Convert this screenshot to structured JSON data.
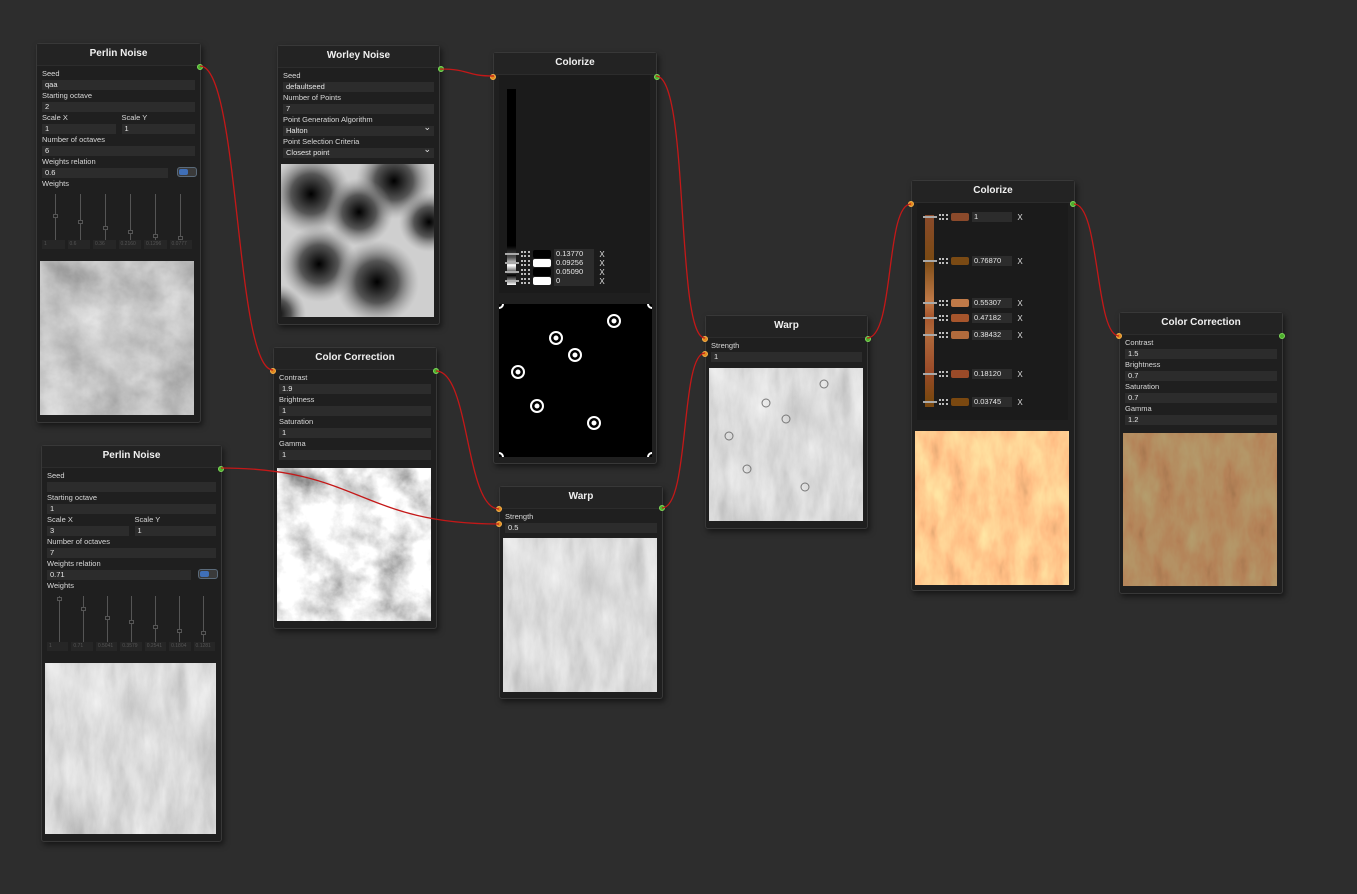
{
  "perlin1": {
    "title": "Perlin Noise",
    "seed_label": "Seed",
    "seed": "qaa",
    "octave_label": "Starting octave",
    "octave": "2",
    "scalex_label": "Scale X",
    "scalex": "1",
    "scaley_label": "Scale Y",
    "scaley": "1",
    "noct_label": "Number of octaves",
    "noct": "6",
    "wrel_label": "Weights relation",
    "wrel": "0.6",
    "weights_label": "Weights",
    "weights": [
      "1",
      "0.6",
      "0.36",
      "0.2160",
      "0.1296",
      "0.0777"
    ],
    "weight_levels": [
      0.55,
      0.4,
      0.27,
      0.18,
      0.1,
      0.05
    ]
  },
  "perlin2": {
    "title": "Perlin Noise",
    "seed_label": "Seed",
    "seed": "",
    "octave_label": "Starting octave",
    "octave": "1",
    "scalex_label": "Scale X",
    "scalex": "3",
    "scaley_label": "Scale Y",
    "scaley": "1",
    "noct_label": "Number of octaves",
    "noct": "7",
    "wrel_label": "Weights relation",
    "wrel": "0.71",
    "weights_label": "Weights",
    "weights": [
      "1",
      "0.71",
      "0.5041",
      "0.3579",
      "0.2541",
      "0.1804",
      "0.1281"
    ],
    "weight_levels": [
      0.98,
      0.75,
      0.55,
      0.45,
      0.35,
      0.25,
      0.2
    ]
  },
  "worley": {
    "title": "Worley Noise",
    "seed_label": "Seed",
    "seed": "defaultseed",
    "points_label": "Number of Points",
    "points": "7",
    "algo_label": "Point Generation Algorithm",
    "algo": "Halton",
    "crit_label": "Point Selection Criteria",
    "crit": "Closest point"
  },
  "cc1": {
    "title": "Color Correction",
    "contrast_label": "Contrast",
    "contrast": "1.9",
    "brightness_label": "Brightness",
    "brightness": "1",
    "saturation_label": "Saturation",
    "saturation": "1",
    "gamma_label": "Gamma",
    "gamma": "1"
  },
  "colorize1": {
    "title": "Colorize",
    "stops": [
      {
        "value": "0.13770",
        "color": "#000000"
      },
      {
        "value": "0.09256",
        "color": "#ffffff"
      },
      {
        "value": "0.05090",
        "color": "#000000"
      },
      {
        "value": "0",
        "color": "#ffffff"
      }
    ],
    "remove_label": "X"
  },
  "warp1": {
    "title": "Warp",
    "strength_label": "Strength",
    "strength": "0.5"
  },
  "warp2": {
    "title": "Warp",
    "strength_label": "Strength",
    "strength": "1"
  },
  "colorize2": {
    "title": "Colorize",
    "stops": [
      {
        "value": "1",
        "color": "#8b4a2b"
      },
      {
        "value": "0.76870",
        "color": "#7a4a14"
      },
      {
        "value": "0.55307",
        "color": "#c07a48"
      },
      {
        "value": "0.47182",
        "color": "#a6552c"
      },
      {
        "value": "0.38432",
        "color": "#b06a3c"
      },
      {
        "value": "0.18120",
        "color": "#9a4a28"
      },
      {
        "value": "0.03745",
        "color": "#7a4810"
      }
    ],
    "remove_label": "X"
  },
  "cc2": {
    "title": "Color Correction",
    "contrast_label": "Contrast",
    "contrast": "1.5",
    "brightness_label": "Brightness",
    "brightness": "0.7",
    "saturation_label": "Saturation",
    "saturation": "0.7",
    "gamma_label": "Gamma",
    "gamma": "1.2"
  }
}
